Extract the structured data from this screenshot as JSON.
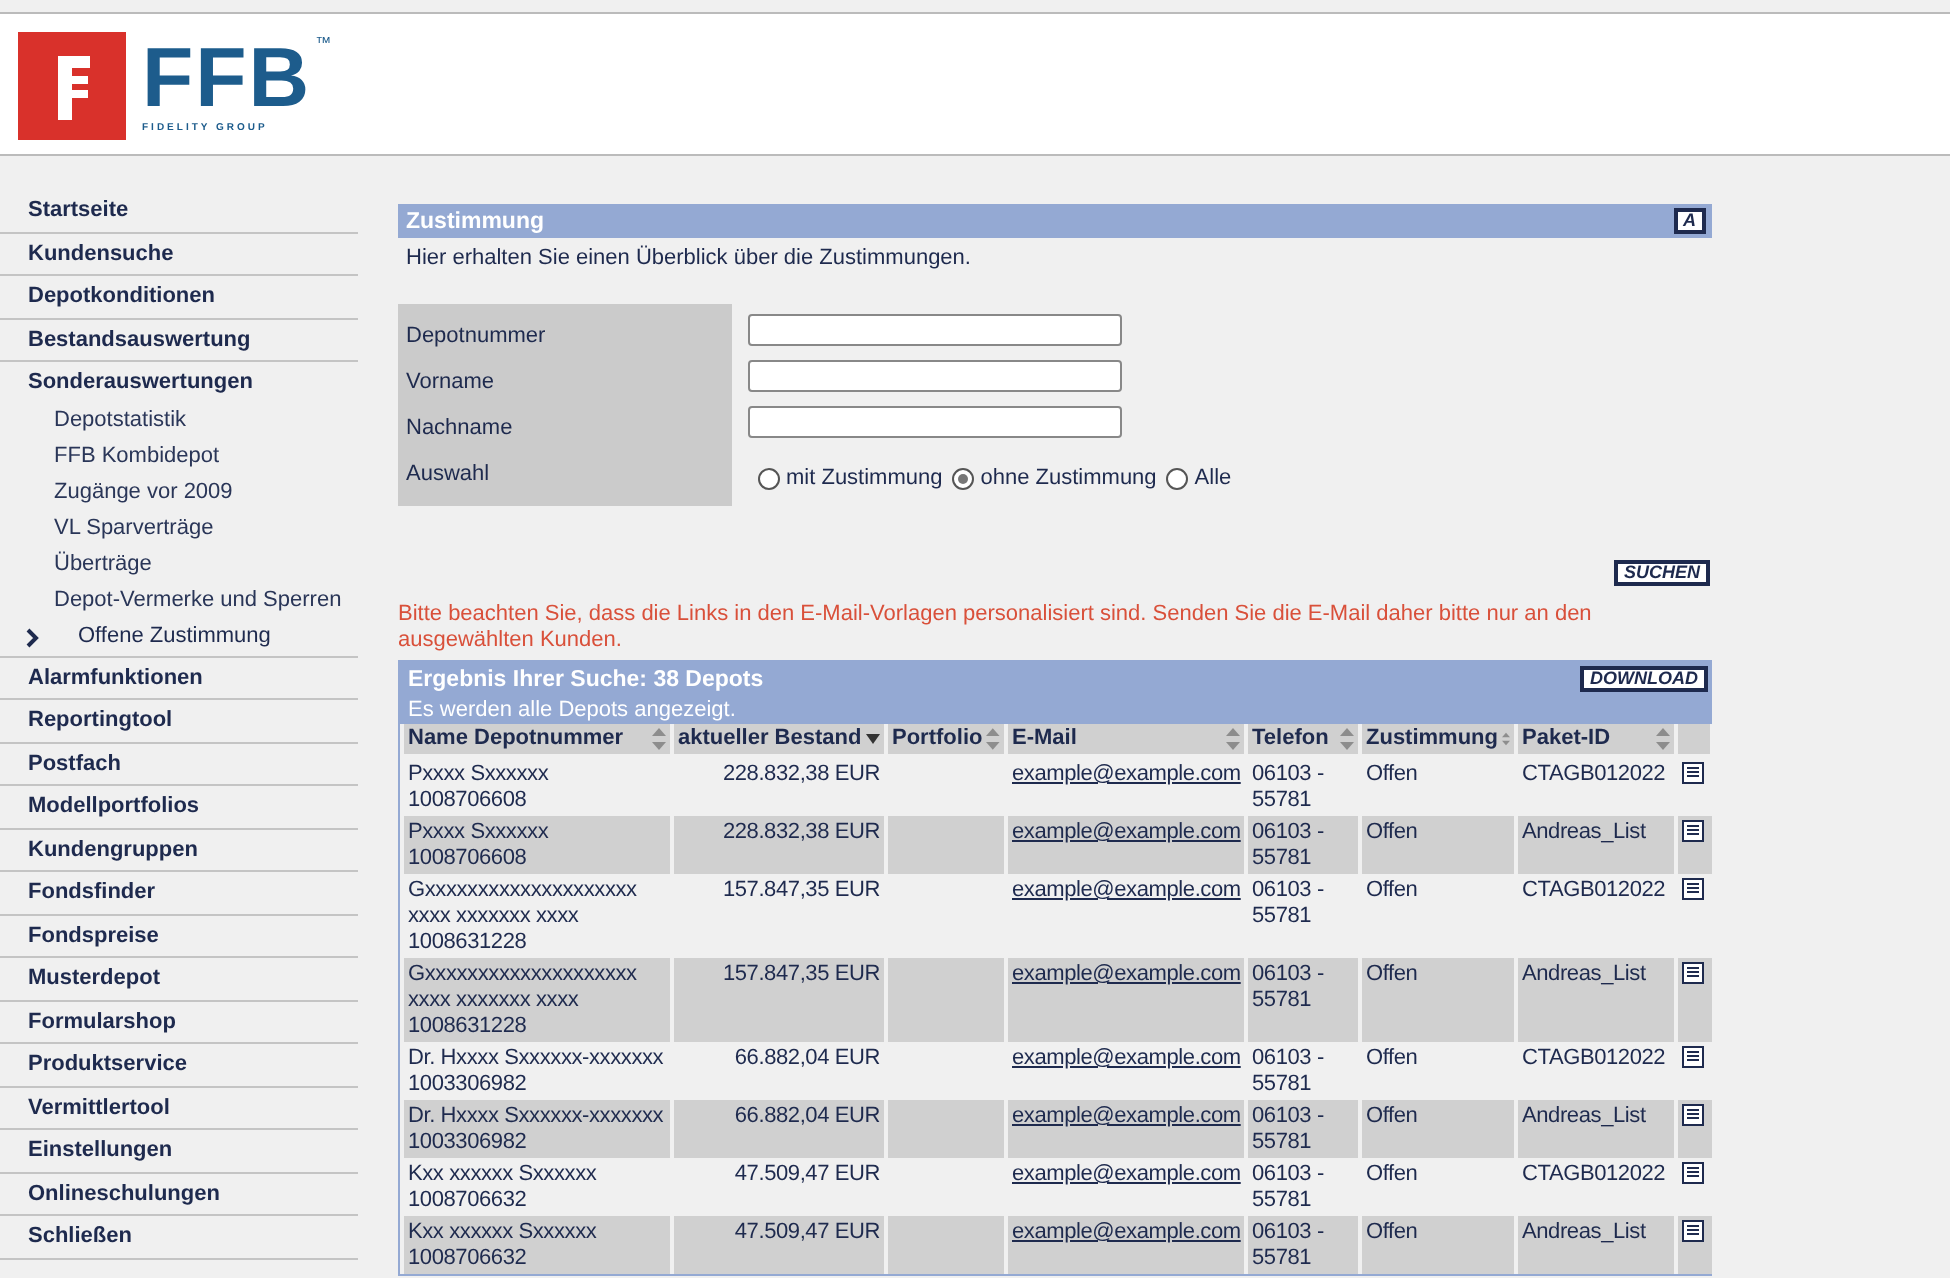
{
  "logo": {
    "wordmark": "FFB",
    "trademark": "™",
    "tagline": "FIDELITY GROUP"
  },
  "sidebar": {
    "items": [
      {
        "label": "Startseite",
        "selected": false
      },
      {
        "label": "Kundensuche",
        "selected": false
      },
      {
        "label": "Depotkonditionen",
        "selected": false
      },
      {
        "label": "Bestandsauswertung",
        "selected": false
      },
      {
        "label": "Sonderauswertungen",
        "selected": false,
        "expanded": true,
        "children": [
          {
            "label": "Depotstatistik",
            "selected": false
          },
          {
            "label": "FFB Kombidepot",
            "selected": false
          },
          {
            "label": "Zugänge vor 2009",
            "selected": false
          },
          {
            "label": "VL Sparverträge",
            "selected": false
          },
          {
            "label": "Überträge",
            "selected": false
          },
          {
            "label": "Depot-Vermerke und Sperren",
            "selected": false
          },
          {
            "label": "Offene Zustimmung",
            "selected": true
          }
        ]
      },
      {
        "label": "Alarmfunktionen",
        "selected": false
      },
      {
        "label": "Reportingtool",
        "selected": false
      },
      {
        "label": "Postfach",
        "selected": false
      },
      {
        "label": "Modellportfolios",
        "selected": false
      },
      {
        "label": "Kundengruppen",
        "selected": false
      },
      {
        "label": "Fondsfinder",
        "selected": false
      },
      {
        "label": "Fondspreise",
        "selected": false
      },
      {
        "label": "Musterdepot",
        "selected": false
      },
      {
        "label": "Formularshop",
        "selected": false
      },
      {
        "label": "Produktservice",
        "selected": false
      },
      {
        "label": "Vermittlertool",
        "selected": false
      },
      {
        "label": "Einstellungen",
        "selected": false
      },
      {
        "label": "Onlineschulungen",
        "selected": false
      },
      {
        "label": "Schließen",
        "selected": false
      }
    ]
  },
  "section": {
    "title": "Zustimmung",
    "button": "A",
    "intro": "Hier erhalten Sie einen Überblick über die Zustimmungen."
  },
  "form": {
    "fields": [
      {
        "label": "Depotnummer"
      },
      {
        "label": "Vorname"
      },
      {
        "label": "Nachname"
      }
    ],
    "choice": {
      "label": "Auswahl",
      "options": [
        {
          "label": "mit Zustimmung",
          "selected": false
        },
        {
          "label": "ohne Zustimmung",
          "selected": true
        },
        {
          "label": "Alle",
          "selected": false
        }
      ]
    },
    "search_button": "SUCHEN"
  },
  "notice": "Bitte beachten Sie, dass die Links in den E-Mail-Vorlagen personalisiert sind. Senden Sie die E-Mail daher bitte nur an den ausgewählten Kunden.",
  "results": {
    "title": "Ergebnis Ihrer Suche: 38 Depots",
    "subtitle": "Es werden alle Depots angezeigt.",
    "download_button": "DOWNLOAD",
    "columns": [
      {
        "label": "Name Depotnummer",
        "sorted": false
      },
      {
        "label": "aktueller Bestand",
        "sorted": true
      },
      {
        "label": "Portfolio",
        "sorted": false
      },
      {
        "label": "E-Mail",
        "sorted": false
      },
      {
        "label": "Telefon",
        "sorted": false
      },
      {
        "label": "Zustimmung",
        "sorted": false
      },
      {
        "label": "Paket-ID",
        "sorted": false
      }
    ],
    "rows": [
      {
        "name": "Pxxxx Sxxxxxx",
        "depot": "1008706608",
        "bestand": "228.832,38 EUR",
        "email": "example@example.com",
        "telefon": "06103 - 55781",
        "zustimmung": "Offen",
        "paket": "CTAGB012022"
      },
      {
        "name": "Pxxxx Sxxxxxx",
        "depot": "1008706608",
        "bestand": "228.832,38 EUR",
        "email": "example@example.com",
        "telefon": "06103 - 55781",
        "zustimmung": "Offen",
        "paket": "Andreas_List"
      },
      {
        "name": "Gxxxxxxxxxxxxxxxxxxxx xxxx xxxxxxx xxxx",
        "depot": "1008631228",
        "bestand": "157.847,35 EUR",
        "email": "example@example.com",
        "telefon": "06103 - 55781",
        "zustimmung": "Offen",
        "paket": "CTAGB012022"
      },
      {
        "name": "Gxxxxxxxxxxxxxxxxxxxx xxxx xxxxxxx xxxx",
        "depot": "1008631228",
        "bestand": "157.847,35 EUR",
        "email": "example@example.com",
        "telefon": "06103 - 55781",
        "zustimmung": "Offen",
        "paket": "Andreas_List"
      },
      {
        "name": "Dr. Hxxxx Sxxxxxx-xxxxxxx",
        "depot": "1003306982",
        "bestand": "66.882,04 EUR",
        "email": "example@example.com",
        "telefon": "06103 - 55781",
        "zustimmung": "Offen",
        "paket": "CTAGB012022"
      },
      {
        "name": "Dr. Hxxxx Sxxxxxx-xxxxxxx",
        "depot": "1003306982",
        "bestand": "66.882,04 EUR",
        "email": "example@example.com",
        "telefon": "06103 - 55781",
        "zustimmung": "Offen",
        "paket": "Andreas_List"
      },
      {
        "name": "Kxx xxxxxx Sxxxxxx",
        "depot": "1008706632",
        "bestand": "47.509,47 EUR",
        "email": "example@example.com",
        "telefon": "06103 - 55781",
        "zustimmung": "Offen",
        "paket": "CTAGB012022"
      },
      {
        "name": "Kxx xxxxxx Sxxxxxx",
        "depot": "1008706632",
        "bestand": "47.509,47 EUR",
        "email": "example@example.com",
        "telefon": "06103 - 55781",
        "zustimmung": "Offen",
        "paket": "Andreas_List"
      }
    ]
  }
}
